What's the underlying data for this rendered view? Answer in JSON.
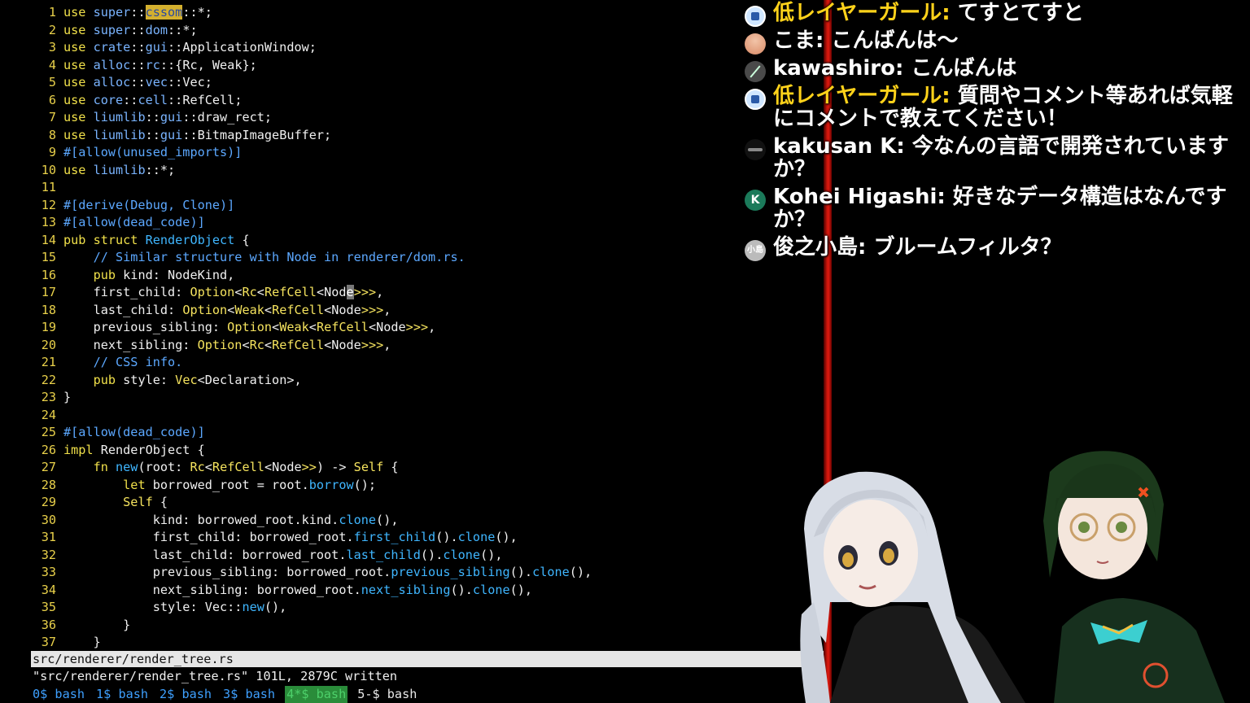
{
  "editor": {
    "lines": [
      {
        "n": "1",
        "tokens": [
          [
            "kw",
            "use "
          ],
          [
            "mod",
            "super"
          ],
          [
            "p",
            "::"
          ],
          [
            "hl",
            "cssom"
          ],
          [
            "p",
            "::*;"
          ]
        ]
      },
      {
        "n": "2",
        "tokens": [
          [
            "kw",
            "use "
          ],
          [
            "mod",
            "super"
          ],
          [
            "p",
            "::"
          ],
          [
            "mod",
            "dom"
          ],
          [
            "p",
            "::*;"
          ]
        ]
      },
      {
        "n": "3",
        "tokens": [
          [
            "kw",
            "use "
          ],
          [
            "mod",
            "crate"
          ],
          [
            "p",
            "::"
          ],
          [
            "mod",
            "gui"
          ],
          [
            "p",
            "::ApplicationWindow;"
          ]
        ]
      },
      {
        "n": "4",
        "tokens": [
          [
            "kw",
            "use "
          ],
          [
            "mod",
            "alloc"
          ],
          [
            "p",
            "::"
          ],
          [
            "mod",
            "rc"
          ],
          [
            "p",
            "::{Rc, Weak};"
          ]
        ]
      },
      {
        "n": "5",
        "tokens": [
          [
            "kw",
            "use "
          ],
          [
            "mod",
            "alloc"
          ],
          [
            "p",
            "::"
          ],
          [
            "mod",
            "vec"
          ],
          [
            "p",
            "::Vec;"
          ]
        ]
      },
      {
        "n": "6",
        "tokens": [
          [
            "kw",
            "use "
          ],
          [
            "mod",
            "core"
          ],
          [
            "p",
            "::"
          ],
          [
            "mod",
            "cell"
          ],
          [
            "p",
            "::RefCell;"
          ]
        ]
      },
      {
        "n": "7",
        "tokens": [
          [
            "kw",
            "use "
          ],
          [
            "mod",
            "liumlib"
          ],
          [
            "p",
            "::"
          ],
          [
            "mod",
            "gui"
          ],
          [
            "p",
            "::draw_rect;"
          ]
        ]
      },
      {
        "n": "8",
        "tokens": [
          [
            "kw",
            "use "
          ],
          [
            "mod",
            "liumlib"
          ],
          [
            "p",
            "::"
          ],
          [
            "mod",
            "gui"
          ],
          [
            "p",
            "::BitmapImageBuffer;"
          ]
        ]
      },
      {
        "n": "9",
        "tokens": [
          [
            "attr",
            "#[allow(unused_imports)]"
          ]
        ]
      },
      {
        "n": "10",
        "tokens": [
          [
            "kw",
            "use "
          ],
          [
            "mod",
            "liumlib"
          ],
          [
            "p",
            "::*;"
          ]
        ]
      },
      {
        "n": "11",
        "tokens": []
      },
      {
        "n": "12",
        "tokens": [
          [
            "attr",
            "#[derive(Debug, Clone)]"
          ]
        ]
      },
      {
        "n": "13",
        "tokens": [
          [
            "attr",
            "#[allow(dead_code)]"
          ]
        ]
      },
      {
        "n": "14",
        "tokens": [
          [
            "kw",
            "pub struct "
          ],
          [
            "fn",
            "RenderObject"
          ],
          [
            "p",
            " {"
          ]
        ]
      },
      {
        "n": "15",
        "tokens": [
          [
            "p",
            "    "
          ],
          [
            "cmt",
            "// Similar structure with Node in renderer/dom.rs."
          ]
        ]
      },
      {
        "n": "16",
        "tokens": [
          [
            "p",
            "    "
          ],
          [
            "kw",
            "pub "
          ],
          [
            "p",
            "kind: NodeKind,"
          ]
        ]
      },
      {
        "n": "17",
        "tokens": [
          [
            "p",
            "    first_child: "
          ],
          [
            "type",
            "Option"
          ],
          [
            "p",
            "<"
          ],
          [
            "type",
            "Rc"
          ],
          [
            "p",
            "<"
          ],
          [
            "type",
            "RefCell"
          ],
          [
            "p",
            "<Nod"
          ],
          [
            "cur",
            "e"
          ],
          [
            "type",
            ">>>"
          ],
          [
            "p",
            ","
          ]
        ]
      },
      {
        "n": "18",
        "tokens": [
          [
            "p",
            "    last_child: "
          ],
          [
            "type",
            "Option"
          ],
          [
            "p",
            "<"
          ],
          [
            "type",
            "Weak"
          ],
          [
            "p",
            "<"
          ],
          [
            "type",
            "RefCell"
          ],
          [
            "p",
            "<Node"
          ],
          [
            "type",
            ">>>"
          ],
          [
            "p",
            ","
          ]
        ]
      },
      {
        "n": "19",
        "tokens": [
          [
            "p",
            "    previous_sibling: "
          ],
          [
            "type",
            "Option"
          ],
          [
            "p",
            "<"
          ],
          [
            "type",
            "Weak"
          ],
          [
            "p",
            "<"
          ],
          [
            "type",
            "RefCell"
          ],
          [
            "p",
            "<Node"
          ],
          [
            "type",
            ">>>"
          ],
          [
            "p",
            ","
          ]
        ]
      },
      {
        "n": "20",
        "tokens": [
          [
            "p",
            "    next_sibling: "
          ],
          [
            "type",
            "Option"
          ],
          [
            "p",
            "<"
          ],
          [
            "type",
            "Rc"
          ],
          [
            "p",
            "<"
          ],
          [
            "type",
            "RefCell"
          ],
          [
            "p",
            "<Node"
          ],
          [
            "type",
            ">>>"
          ],
          [
            "p",
            ","
          ]
        ]
      },
      {
        "n": "21",
        "tokens": [
          [
            "p",
            "    "
          ],
          [
            "cmt",
            "// CSS info."
          ]
        ]
      },
      {
        "n": "22",
        "tokens": [
          [
            "p",
            "    "
          ],
          [
            "kw",
            "pub "
          ],
          [
            "p",
            "style: "
          ],
          [
            "type",
            "Vec"
          ],
          [
            "p",
            "<Declaration>,"
          ]
        ]
      },
      {
        "n": "23",
        "tokens": [
          [
            "p",
            "}"
          ]
        ]
      },
      {
        "n": "24",
        "tokens": []
      },
      {
        "n": "25",
        "tokens": [
          [
            "attr",
            "#[allow(dead_code)]"
          ]
        ]
      },
      {
        "n": "26",
        "tokens": [
          [
            "kw",
            "impl "
          ],
          [
            "p",
            "RenderObject {"
          ]
        ]
      },
      {
        "n": "27",
        "tokens": [
          [
            "p",
            "    "
          ],
          [
            "kw",
            "fn "
          ],
          [
            "fn",
            "new"
          ],
          [
            "p",
            "(root: "
          ],
          [
            "type",
            "Rc"
          ],
          [
            "p",
            "<"
          ],
          [
            "type",
            "RefCell"
          ],
          [
            "p",
            "<Node"
          ],
          [
            "type",
            ">>"
          ],
          [
            "p",
            ") -> "
          ],
          [
            "type",
            "Self"
          ],
          [
            "p",
            " {"
          ]
        ]
      },
      {
        "n": "28",
        "tokens": [
          [
            "p",
            "        "
          ],
          [
            "kw",
            "let "
          ],
          [
            "p",
            "borrowed_root = root."
          ],
          [
            "fn",
            "borrow"
          ],
          [
            "p",
            "();"
          ]
        ]
      },
      {
        "n": "29",
        "tokens": [
          [
            "p",
            "        "
          ],
          [
            "type",
            "Self"
          ],
          [
            "p",
            " {"
          ]
        ]
      },
      {
        "n": "30",
        "tokens": [
          [
            "p",
            "            kind: borrowed_root.kind."
          ],
          [
            "fn",
            "clone"
          ],
          [
            "p",
            "(),"
          ]
        ]
      },
      {
        "n": "31",
        "tokens": [
          [
            "p",
            "            first_child: borrowed_root."
          ],
          [
            "fn",
            "first_child"
          ],
          [
            "p",
            "()."
          ],
          [
            "fn",
            "clone"
          ],
          [
            "p",
            "(),"
          ]
        ]
      },
      {
        "n": "32",
        "tokens": [
          [
            "p",
            "            last_child: borrowed_root."
          ],
          [
            "fn",
            "last_child"
          ],
          [
            "p",
            "()."
          ],
          [
            "fn",
            "clone"
          ],
          [
            "p",
            "(),"
          ]
        ]
      },
      {
        "n": "33",
        "tokens": [
          [
            "p",
            "            previous_sibling: borrowed_root."
          ],
          [
            "fn",
            "previous_sibling"
          ],
          [
            "p",
            "()."
          ],
          [
            "fn",
            "clone"
          ],
          [
            "p",
            "(),"
          ]
        ]
      },
      {
        "n": "34",
        "tokens": [
          [
            "p",
            "            next_sibling: borrowed_root."
          ],
          [
            "fn",
            "next_sibling"
          ],
          [
            "p",
            "()."
          ],
          [
            "fn",
            "clone"
          ],
          [
            "p",
            "(),"
          ]
        ]
      },
      {
        "n": "35",
        "tokens": [
          [
            "p",
            "            style: Vec::"
          ],
          [
            "fn",
            "new"
          ],
          [
            "p",
            "(),"
          ]
        ]
      },
      {
        "n": "36",
        "tokens": [
          [
            "p",
            "        }"
          ]
        ]
      },
      {
        "n": "37",
        "tokens": [
          [
            "p",
            "    }"
          ]
        ]
      }
    ],
    "status_filename": "src/renderer/render_tree.rs",
    "command_message": "\"src/renderer/render_tree.rs\" 101L, 2879C written"
  },
  "tmux": {
    "windows": [
      {
        "label": "0$ bash",
        "state": "normal"
      },
      {
        "label": "1$ bash",
        "state": "normal"
      },
      {
        "label": "2$ bash",
        "state": "normal"
      },
      {
        "label": "3$ bash",
        "state": "normal"
      },
      {
        "label": "4*$ bash",
        "state": "active"
      },
      {
        "label": "5-$ bash",
        "state": "plain"
      }
    ]
  },
  "chat": {
    "messages": [
      {
        "avatar": "chip",
        "avatar_text": "",
        "name": "低レイヤーガール",
        "member": true,
        "text": "てすとてすと"
      },
      {
        "avatar": "peach",
        "avatar_text": "",
        "name": "こま",
        "member": false,
        "text": "こんばんは〜"
      },
      {
        "avatar": "leaf",
        "avatar_text": "",
        "name": "kawashiro",
        "member": false,
        "text": "こんばんは"
      },
      {
        "avatar": "chip",
        "avatar_text": "",
        "name": "低レイヤーガール",
        "member": true,
        "text": "質問やコメント等あれば気軽にコメントで教えてください！"
      },
      {
        "avatar": "bird",
        "avatar_text": "",
        "name": "kakusan K",
        "member": false,
        "text": "今なんの言語で開発されていますか？"
      },
      {
        "avatar": "k",
        "avatar_text": "K",
        "name": "Kohei Higashi",
        "member": false,
        "text": "好きなデータ構造はなんですか？"
      },
      {
        "avatar": "gray",
        "avatar_text": "小島",
        "name": "俊之小島",
        "member": false,
        "text": "ブルームフィルタ？"
      }
    ]
  },
  "colors": {
    "divider": "#e01a10",
    "member_name": "#ffd21a",
    "line_number": "#e8d04a",
    "tmux_active": "#2a8c3a"
  }
}
